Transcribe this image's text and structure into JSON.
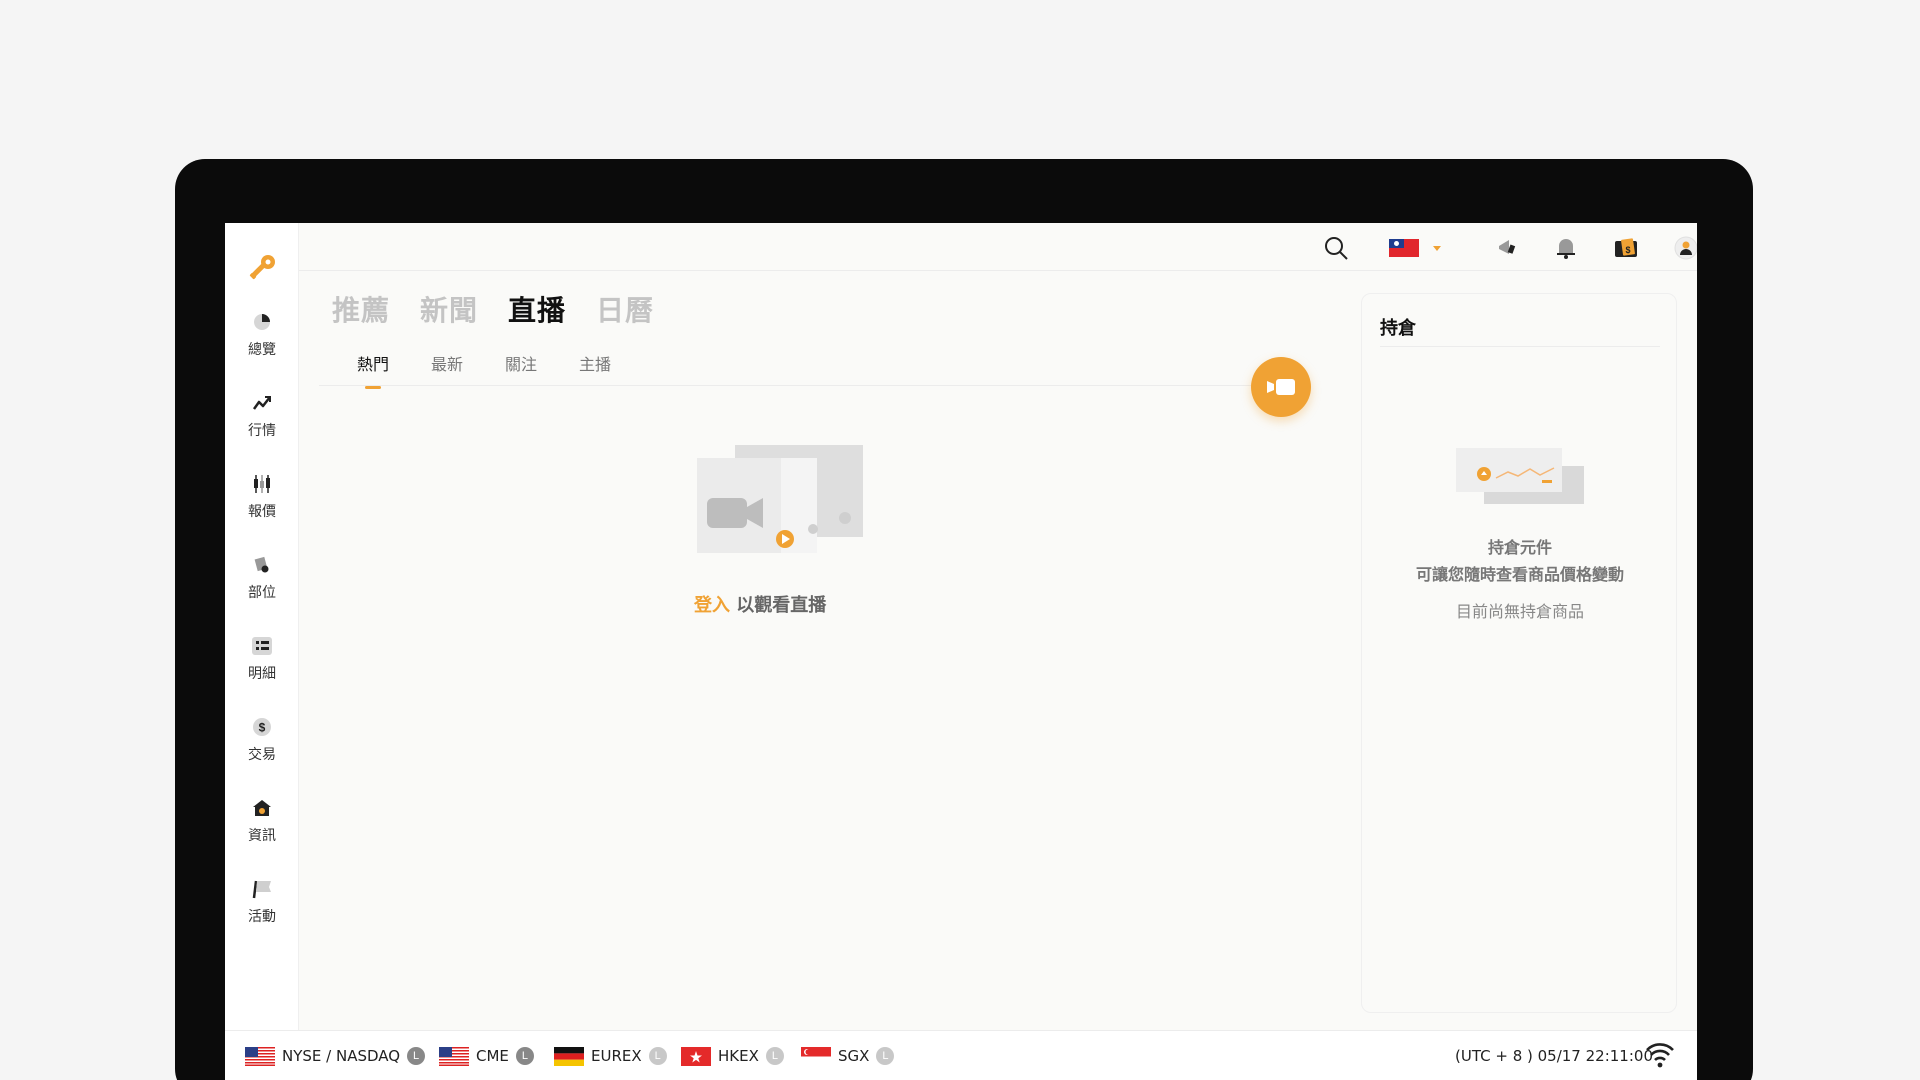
{
  "sidebar": {
    "items": [
      {
        "label": "總覽",
        "icon": "pie-chart-icon"
      },
      {
        "label": "行情",
        "icon": "trend-chart-icon"
      },
      {
        "label": "報價",
        "icon": "candlestick-icon"
      },
      {
        "label": "部位",
        "icon": "position-tag-icon"
      },
      {
        "label": "明細",
        "icon": "list-detail-icon"
      },
      {
        "label": "交易",
        "icon": "dollar-coin-icon"
      },
      {
        "label": "資訊",
        "icon": "info-house-icon"
      },
      {
        "label": "活動",
        "icon": "flag-icon"
      }
    ]
  },
  "main_tabs": [
    "推薦",
    "新聞",
    "直播",
    "日曆"
  ],
  "active_main_tab": "直播",
  "sub_tabs": [
    "熱門",
    "最新",
    "關注",
    "主播"
  ],
  "active_sub_tab": "熱門",
  "live_empty": {
    "login_link": "登入",
    "login_suffix": " 以觀看直播"
  },
  "positions_panel": {
    "title": "持倉",
    "line1": "持倉元件",
    "line2": "可讓您隨時查看商品價格變動",
    "line3": "目前尚無持倉商品"
  },
  "statusbar": {
    "exchanges": [
      {
        "name": "NYSE / NASDAQ",
        "flag": "us",
        "status": "L"
      },
      {
        "name": "CME",
        "flag": "us",
        "status": "L"
      },
      {
        "name": "EUREX",
        "flag": "de",
        "status": "L"
      },
      {
        "name": "HKEX",
        "flag": "hk",
        "status": "L"
      },
      {
        "name": "SGX",
        "flag": "sg",
        "status": "L"
      }
    ],
    "clock": "(UTC + 8 ) 05/17 22:11:00"
  },
  "colors": {
    "accent": "#f0a234",
    "frame": "#0b0b0b",
    "bg": "#fafaf8"
  }
}
